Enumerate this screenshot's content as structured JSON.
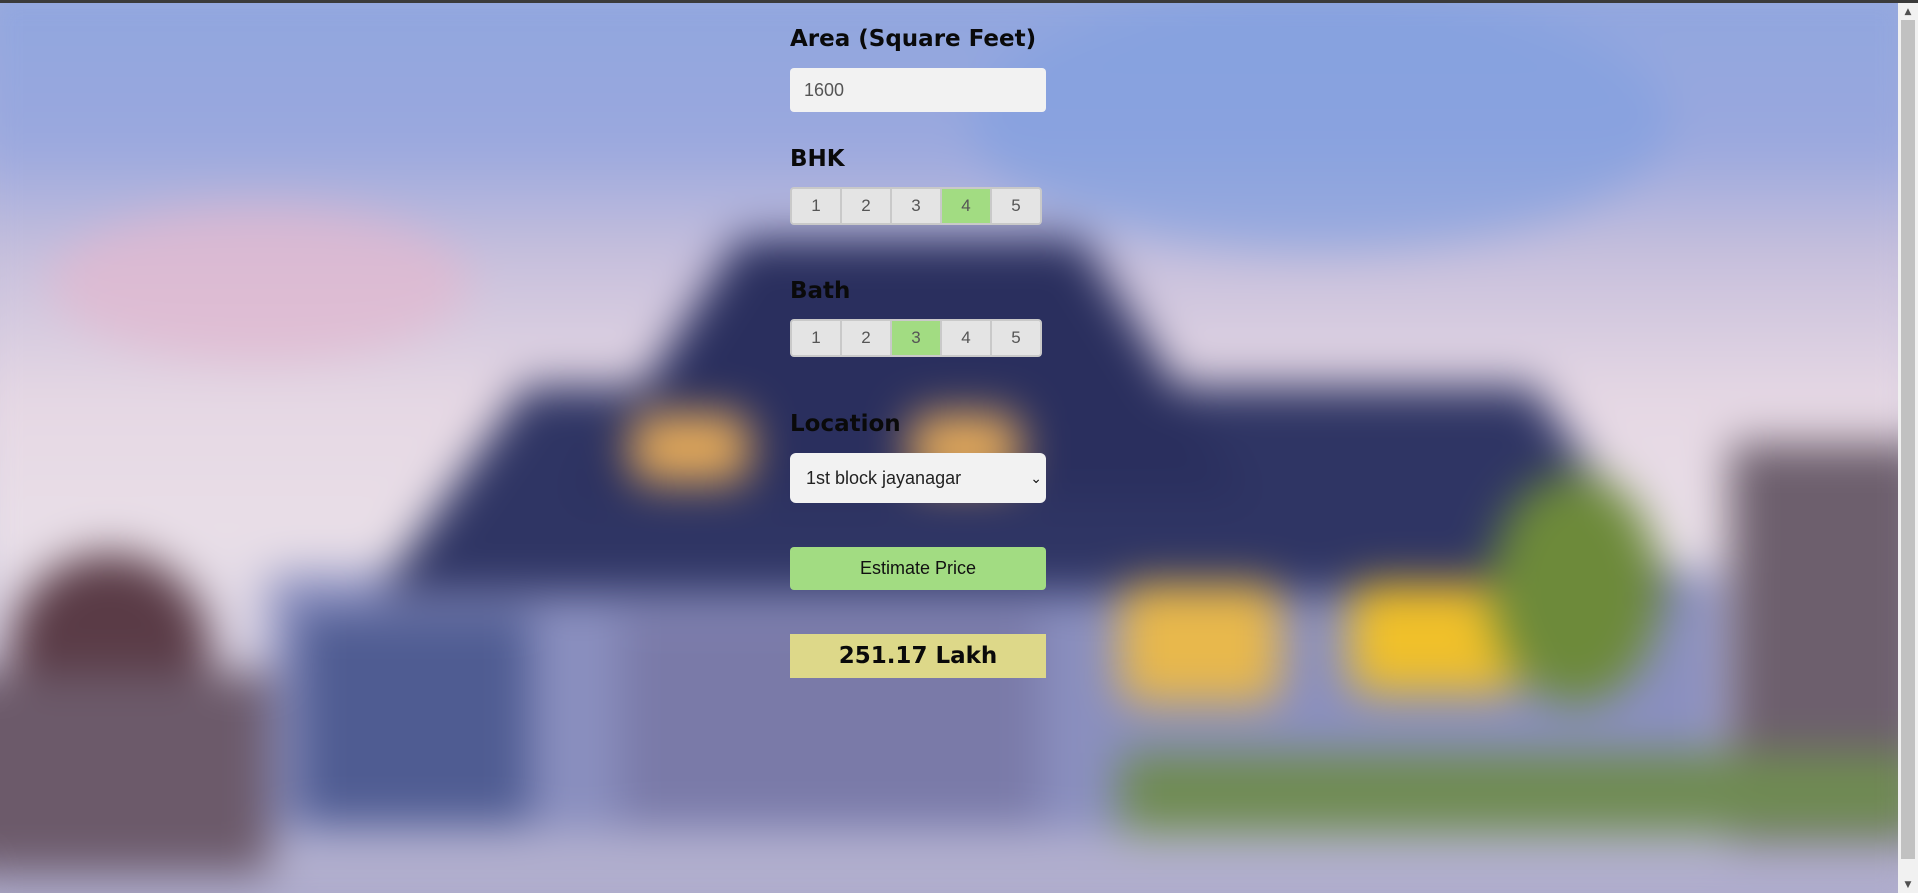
{
  "form": {
    "area": {
      "label": "Area (Square Feet)",
      "value": "1600"
    },
    "bhk": {
      "label": "BHK",
      "options": [
        "1",
        "2",
        "3",
        "4",
        "5"
      ],
      "selected": "4"
    },
    "bath": {
      "label": "Bath",
      "options": [
        "1",
        "2",
        "3",
        "4",
        "5"
      ],
      "selected": "3"
    },
    "location": {
      "label": "Location",
      "selected": "1st block jayanagar"
    },
    "estimate_button": "Estimate Price",
    "result": "251.17 Lakh"
  },
  "colors": {
    "selected_option": "#a2dc82",
    "button": "#a2dc82",
    "result_background": "#ddd889"
  }
}
